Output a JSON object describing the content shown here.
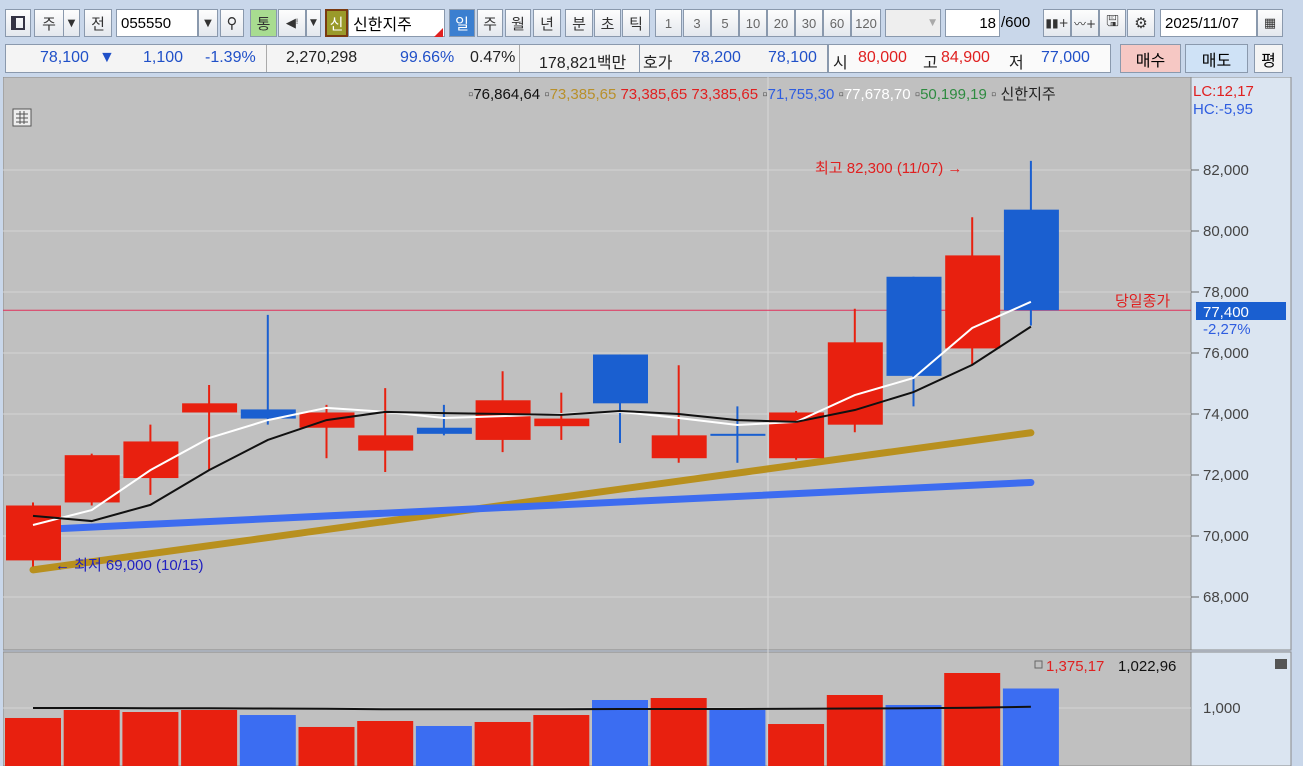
{
  "toolbar": {
    "period_unit": "주",
    "prev_label": "전",
    "code": "055550",
    "tong": "통",
    "shin": "신",
    "stock_name": "신한지주",
    "periods": [
      "일",
      "주",
      "월",
      "년",
      "분",
      "초",
      "틱"
    ],
    "intervals": [
      "1",
      "3",
      "5",
      "10",
      "20",
      "30",
      "60",
      "120"
    ],
    "count": "18",
    "count_max": "/600",
    "date": "2025/11/07"
  },
  "quote": {
    "price": "78,100",
    "arrow": "▼",
    "change": "1,100",
    "change_pct": "-1.39%",
    "volume": "2,270,298",
    "vol_ratio": "99.66%",
    "turnover": "0.47%",
    "amount": "178,821백만",
    "hoga_label": "호가",
    "ask": "78,200",
    "bid": "78,100",
    "open_label": "시",
    "open": "80,000",
    "high_label": "고",
    "high": "84,900",
    "low_label": "저",
    "low": "77,000",
    "buy_label": "매수",
    "sell_label": "매도",
    "eval_label": "평"
  },
  "legend": {
    "ma_values": [
      {
        "text": "76,864,64",
        "color": "#111111"
      },
      {
        "text": "73,385,65",
        "color": "#b8902a"
      },
      {
        "text": "73,385,65",
        "color": "#e02020"
      },
      {
        "text": "73,385,65",
        "color": "#e02020"
      },
      {
        "text": "71,755,30",
        "color": "#2e5de0"
      },
      {
        "text": "77,678,70",
        "color": "#ffffff"
      },
      {
        "text": "50,199,19",
        "color": "#2e8b40"
      }
    ],
    "name": "신한지주",
    "lc": "LC:12,17",
    "hc": "HC:-5,95"
  },
  "annotations": {
    "high_note": "최고 82,300 (11/07) →",
    "low_note": "← 최저 69,000 (10/15)",
    "close_label": "당일종가",
    "close_value": "77,400",
    "close_pct": "-2,27%",
    "vol_legend_1": "1,375,17",
    "vol_legend_2": "1,022,96"
  },
  "colors": {
    "up": "#e8200f",
    "down": "#1a5fd0",
    "vol_down": "#3b6df2",
    "bg": "#c0c0c0",
    "axis_bg": "#dbe5f1"
  },
  "chart_data": {
    "type": "candlestick",
    "price_axis": {
      "ticks": [
        "82,000",
        "80,000",
        "78,000",
        "76,000",
        "74,000",
        "72,000",
        "70,000",
        "68,000"
      ],
      "range": [
        66500,
        84000
      ]
    },
    "candles": [
      [
        69200,
        71100,
        69000,
        71000
      ],
      [
        71100,
        72700,
        71000,
        72650
      ],
      [
        71900,
        73650,
        71350,
        73100
      ],
      [
        74050,
        74950,
        72150,
        74350
      ],
      [
        74150,
        77250,
        73650,
        73850
      ],
      [
        73550,
        74300,
        72550,
        74050
      ],
      [
        72800,
        74850,
        72100,
        73300
      ],
      [
        73550,
        74300,
        73300,
        73350
      ],
      [
        73150,
        75400,
        72750,
        74450
      ],
      [
        73600,
        74700,
        73150,
        73850
      ],
      [
        75950,
        75950,
        73050,
        74350
      ],
      [
        72550,
        75600,
        72400,
        73300
      ],
      [
        73350,
        74250,
        72400,
        73300
      ],
      [
        72550,
        74100,
        72500,
        74050
      ],
      [
        73650,
        77450,
        73400,
        76350
      ],
      [
        78500,
        78500,
        74250,
        75250
      ],
      [
        76150,
        80450,
        75600,
        79200
      ],
      [
        80700,
        82300,
        76900,
        77400
      ]
    ],
    "ma_white": [
      70360,
      70850,
      72160,
      73210,
      73800,
      74200,
      74070,
      73870,
      73930,
      74000,
      74070,
      73870,
      73640,
      73740,
      74620,
      75180,
      76820,
      77679
    ],
    "ma_black": [
      70660,
      70490,
      71020,
      72160,
      73150,
      73800,
      74070,
      74030,
      74000,
      73970,
      74100,
      74000,
      73800,
      73740,
      74130,
      74720,
      75610,
      76865
    ],
    "ma_gold": [
      68890,
      73386
    ],
    "ma_blue": [
      70200,
      71755
    ],
    "close_line": 77400,
    "volume_axis": {
      "ticks": [
        "1,000"
      ]
    },
    "volume": [
      808,
      962,
      923,
      962,
      865,
      635,
      750,
      654,
      731,
      865,
      1154,
      1192,
      962,
      692,
      1250,
      1058,
      1673,
      1375
    ],
    "volume_ma": [
      1000,
      1000,
      995,
      995,
      990,
      985,
      975,
      975,
      975,
      975,
      980,
      980,
      980,
      985,
      990,
      995,
      1005,
      1023
    ]
  }
}
